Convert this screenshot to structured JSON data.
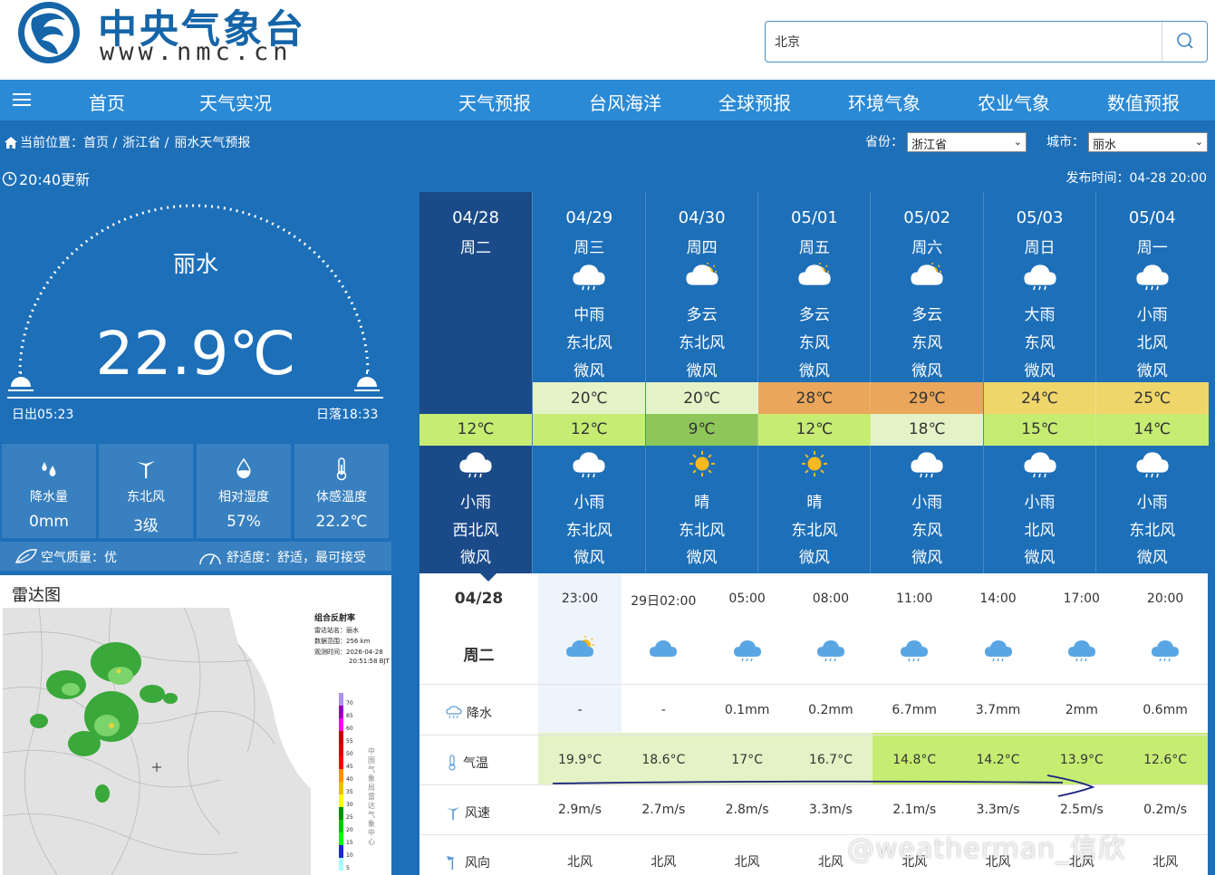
{
  "header": {
    "logo_title": "中央气象台",
    "logo_url": "www.nmc.cn",
    "search_value": "北京"
  },
  "nav": {
    "items": [
      "首页",
      "天气实况",
      "天气预报",
      "台风海洋",
      "全球预报",
      "环境气象",
      "农业气象",
      "数值预报"
    ]
  },
  "breadcrumb": {
    "prefix": "当前位置：首页 /",
    "province": "浙江省 /",
    "page": "丽水天气预报"
  },
  "selectors": {
    "province_label": "省份：",
    "province_value": "浙江省",
    "city_label": "城市：",
    "city_value": "丽水"
  },
  "update_time": "20:40更新",
  "publish_time": "发布时间：04-28 20:00",
  "current": {
    "city": "丽水",
    "temperature": "22.9℃",
    "sunrise": "日出05:23",
    "sunset": "日落18:33",
    "stats": [
      {
        "label": "降水量",
        "value": "0mm",
        "icon": "raindrop-icon"
      },
      {
        "label": "东北风",
        "value": "3级",
        "icon": "wind-turbine-icon"
      },
      {
        "label": "相对湿度",
        "value": "57%",
        "icon": "humidity-icon"
      },
      {
        "label": "体感温度",
        "value": "22.2℃",
        "icon": "thermometer-icon"
      }
    ],
    "air_quality": "空气质量：优",
    "comfort": "舒适度：舒适，最可接受"
  },
  "radar": {
    "title": "雷达图",
    "legend_title": "组合反射率",
    "station": "雷达站名：丽水",
    "range": "数据范围：256 km",
    "time": "观测时间：2026-04-28",
    "time2": "20:51:58 BJT",
    "scale": [
      "70",
      "65",
      "60",
      "55",
      "50",
      "45",
      "40",
      "35",
      "30",
      "25",
      "20",
      "15",
      "10",
      "5"
    ],
    "vertical_text": "中国气象局雷达气象中心"
  },
  "forecast": {
    "days": [
      {
        "date": "04/28",
        "week": "周二",
        "day_icon": "",
        "day_weather": "",
        "day_wind_dir": "",
        "day_wind": "",
        "high": "",
        "low": "12℃",
        "night_icon": "rain-cloud-icon",
        "night_weather": "小雨",
        "night_wind_dir": "西北风",
        "night_wind": "微风"
      },
      {
        "date": "04/29",
        "week": "周三",
        "day_icon": "rain-cloud-icon",
        "day_weather": "中雨",
        "day_wind_dir": "东北风",
        "day_wind": "微风",
        "high": "20℃",
        "low": "12℃",
        "night_icon": "rain-cloud-icon",
        "night_weather": "小雨",
        "night_wind_dir": "东北风",
        "night_wind": "微风"
      },
      {
        "date": "04/30",
        "week": "周四",
        "day_icon": "partly-cloudy-icon",
        "day_weather": "多云",
        "day_wind_dir": "东北风",
        "day_wind": "微风",
        "high": "20℃",
        "low": "9℃",
        "night_icon": "sun-icon",
        "night_weather": "晴",
        "night_wind_dir": "东北风",
        "night_wind": "微风"
      },
      {
        "date": "05/01",
        "week": "周五",
        "day_icon": "partly-cloudy-icon",
        "day_weather": "多云",
        "day_wind_dir": "东风",
        "day_wind": "微风",
        "high": "28℃",
        "low": "12℃",
        "night_icon": "sun-icon",
        "night_weather": "晴",
        "night_wind_dir": "东北风",
        "night_wind": "微风"
      },
      {
        "date": "05/02",
        "week": "周六",
        "day_icon": "partly-cloudy-icon",
        "day_weather": "多云",
        "day_wind_dir": "东风",
        "day_wind": "微风",
        "high": "29℃",
        "low": "18℃",
        "night_icon": "rain-cloud-icon",
        "night_weather": "小雨",
        "night_wind_dir": "东风",
        "night_wind": "微风"
      },
      {
        "date": "05/03",
        "week": "周日",
        "day_icon": "rain-cloud-icon",
        "day_weather": "大雨",
        "day_wind_dir": "东风",
        "day_wind": "微风",
        "high": "24℃",
        "low": "15℃",
        "night_icon": "rain-cloud-icon",
        "night_weather": "小雨",
        "night_wind_dir": "北风",
        "night_wind": "微风"
      },
      {
        "date": "05/04",
        "week": "周一",
        "day_icon": "rain-cloud-icon",
        "day_weather": "小雨",
        "day_wind_dir": "北风",
        "day_wind": "微风",
        "high": "25℃",
        "low": "14℃",
        "night_icon": "rain-cloud-icon",
        "night_weather": "小雨",
        "night_wind_dir": "东北风",
        "night_wind": "微风"
      }
    ],
    "colors": {
      "today": "#1a4a88",
      "high_bg": [
        "",
        "#e4f3c7",
        "#e4f3c7",
        "#eaa65a",
        "#eaa65a",
        "#efd66b",
        "#efd66b"
      ],
      "low_bg": [
        "#c6ec72",
        "#c6ec72",
        "#8fc65a",
        "#c6ec72",
        "#e4f3c7",
        "#c6ec72",
        "#c6ec72"
      ]
    }
  },
  "hourly": {
    "date": "04/28",
    "week": "周二",
    "labels": {
      "rain": "降水",
      "temp": "气温",
      "speed": "风速",
      "dir": "风向"
    },
    "times": [
      "23:00",
      "29日02:00",
      "05:00",
      "08:00",
      "11:00",
      "14:00",
      "17:00",
      "20:00"
    ],
    "icons": [
      "partly-cloudy-icon",
      "cloud-icon",
      "rain-cloud-icon",
      "rain-cloud-icon",
      "rain-cloud-icon",
      "rain-cloud-icon",
      "rain-cloud-icon",
      "rain-cloud-icon"
    ],
    "rain": [
      "-",
      "-",
      "0.1mm",
      "0.2mm",
      "6.7mm",
      "3.7mm",
      "2mm",
      "0.6mm"
    ],
    "temp": [
      "19.9°C",
      "18.6°C",
      "17°C",
      "16.7°C",
      "14.8°C",
      "14.2°C",
      "13.9°C",
      "12.6°C"
    ],
    "speed": [
      "2.9m/s",
      "2.7m/s",
      "2.8m/s",
      "3.3m/s",
      "2.1m/s",
      "3.3m/s",
      "2.5m/s",
      "0.2m/s"
    ],
    "dir": [
      "北风",
      "北风",
      "北风",
      "北风",
      "北风",
      "北风",
      "北风",
      "北风"
    ]
  },
  "watermark": "@weatherman_信欣"
}
